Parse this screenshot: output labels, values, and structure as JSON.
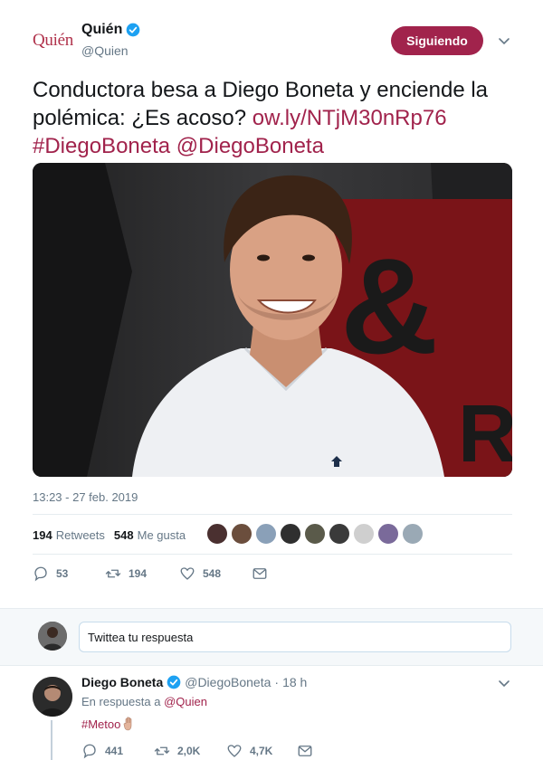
{
  "tweet": {
    "logo_text": "Quién",
    "author_name": "Quién",
    "author_handle": "@Quien",
    "follow_label": "Siguiendo",
    "text_plain": "Conductora besa a Diego Boneta y enciende la polémica: ¿Es acoso?",
    "link_text": "ow.ly/NTjM30nRp76",
    "hashtag": "#DiegoBoneta",
    "mention": "@DiegoBoneta",
    "timestamp": "13:23 - 27 feb. 2019",
    "retweets_count": "194",
    "retweets_label": "Retweets",
    "likes_count": "548",
    "likes_label": "Me gusta",
    "actions": {
      "replies": "53",
      "retweets": "194",
      "likes": "548"
    },
    "liker_colors": [
      "#4a3030",
      "#6b4e3d",
      "#8aa0b8",
      "#2f2f2f",
      "#5a5a4a",
      "#3a3a3a",
      "#cfcfcf",
      "#7a6a9a",
      "#9aa9b5"
    ]
  },
  "reply_box": {
    "placeholder": "Twittea tu respuesta"
  },
  "reply": {
    "name": "Diego Boneta",
    "handle": "@DiegoBoneta",
    "separator": "·",
    "time": "18 h",
    "in_reply_prefix": "En respuesta a",
    "in_reply_handle": "@Quien",
    "text": "#Metoo",
    "actions": {
      "replies": "441",
      "retweets": "2,0K",
      "likes": "4,7K"
    }
  },
  "colors": {
    "brand": "#a1234c",
    "verified": "#1da1f2",
    "muted": "#657786"
  }
}
